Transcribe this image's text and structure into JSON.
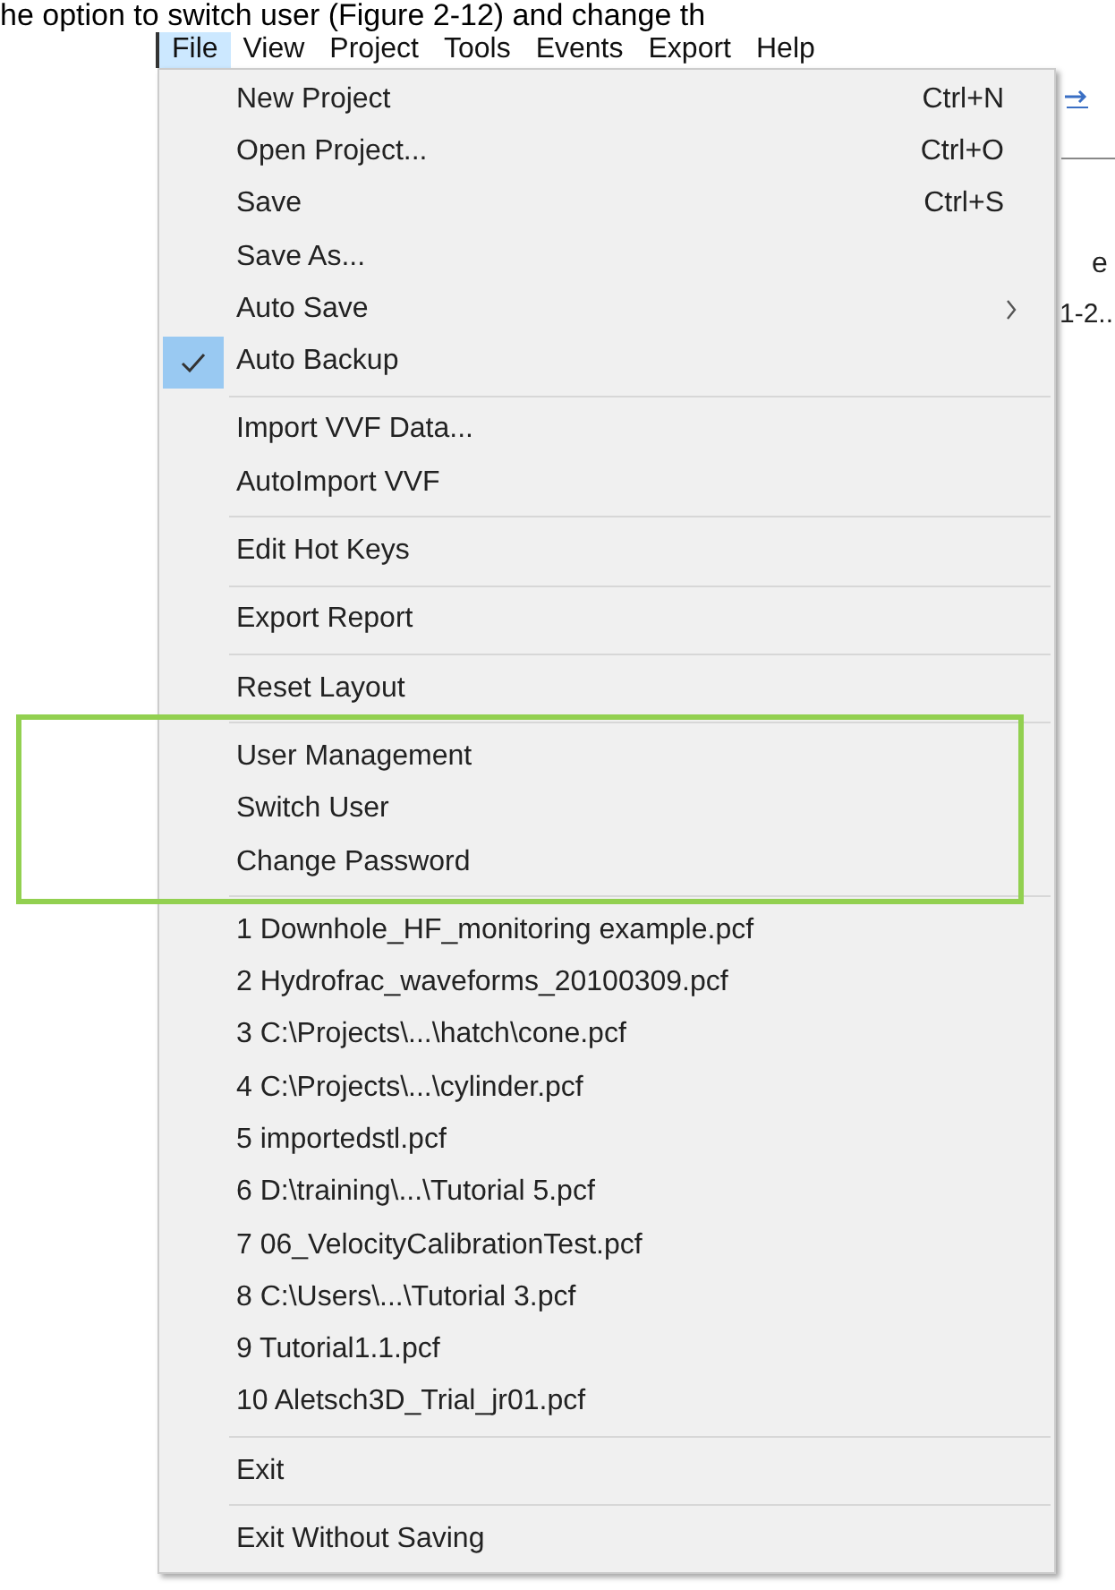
{
  "caption": "he option to switch user (Figure 2-12) and change th",
  "menubar": [
    {
      "label": "File",
      "selected": true
    },
    {
      "label": "View",
      "selected": false
    },
    {
      "label": "Project",
      "selected": false
    },
    {
      "label": "Tools",
      "selected": false
    },
    {
      "label": "Events",
      "selected": false
    },
    {
      "label": "Export",
      "selected": false
    },
    {
      "label": "Help",
      "selected": false
    }
  ],
  "menu": {
    "sections": [
      {
        "highlighted": false,
        "items": [
          {
            "label": "New Project",
            "shortcut": "Ctrl+N",
            "checked": false,
            "submenu": false
          },
          {
            "label": "Open Project...",
            "shortcut": "Ctrl+O",
            "checked": false,
            "submenu": false
          },
          {
            "label": "Save",
            "shortcut": "Ctrl+S",
            "checked": false,
            "submenu": false
          },
          {
            "label": "Save As...",
            "checked": false,
            "submenu": false
          },
          {
            "label": "Auto Save",
            "checked": false,
            "submenu": true
          },
          {
            "label": "Auto Backup",
            "checked": true,
            "submenu": false
          }
        ]
      },
      {
        "highlighted": false,
        "items": [
          {
            "label": "Import VVF Data...",
            "checked": false,
            "submenu": false
          },
          {
            "label": "AutoImport VVF",
            "checked": false,
            "submenu": false
          }
        ]
      },
      {
        "highlighted": false,
        "items": [
          {
            "label": "Edit Hot Keys",
            "checked": false,
            "submenu": false
          }
        ]
      },
      {
        "highlighted": false,
        "items": [
          {
            "label": "Export Report",
            "checked": false,
            "submenu": false
          }
        ]
      },
      {
        "highlighted": false,
        "items": [
          {
            "label": "Reset Layout",
            "checked": false,
            "submenu": false
          }
        ]
      },
      {
        "highlighted": true,
        "items": [
          {
            "label": "User Management",
            "checked": false,
            "submenu": false
          },
          {
            "label": "Switch User",
            "checked": false,
            "submenu": false
          },
          {
            "label": "Change Password",
            "checked": false,
            "submenu": false
          }
        ]
      },
      {
        "highlighted": false,
        "items": [
          {
            "label": "1 Downhole_HF_monitoring example.pcf",
            "checked": false,
            "submenu": false
          },
          {
            "label": "2 Hydrofrac_waveforms_20100309.pcf",
            "checked": false,
            "submenu": false
          },
          {
            "label": "3 C:\\Projects\\...\\hatch\\cone.pcf",
            "checked": false,
            "submenu": false
          },
          {
            "label": "4 C:\\Projects\\...\\cylinder.pcf",
            "checked": false,
            "submenu": false
          },
          {
            "label": "5 importedstl.pcf",
            "checked": false,
            "submenu": false
          },
          {
            "label": "6 D:\\training\\...\\Tutorial 5.pcf",
            "checked": false,
            "submenu": false
          },
          {
            "label": "7 06_VelocityCalibrationTest.pcf",
            "checked": false,
            "submenu": false
          },
          {
            "label": "8 C:\\Users\\...\\Tutorial 3.pcf",
            "checked": false,
            "submenu": false
          },
          {
            "label": "9 Tutorial1.1.pcf",
            "checked": false,
            "submenu": false
          },
          {
            "label": "10 Aletsch3D_Trial_jr01.pcf",
            "checked": false,
            "submenu": false
          }
        ]
      },
      {
        "highlighted": false,
        "items": [
          {
            "label": "Exit",
            "checked": false,
            "submenu": false
          }
        ]
      },
      {
        "highlighted": false,
        "items": [
          {
            "label": "Exit Without Saving",
            "checked": false,
            "submenu": false
          }
        ]
      }
    ]
  },
  "background_texts": [
    "e",
    "1-2.."
  ]
}
